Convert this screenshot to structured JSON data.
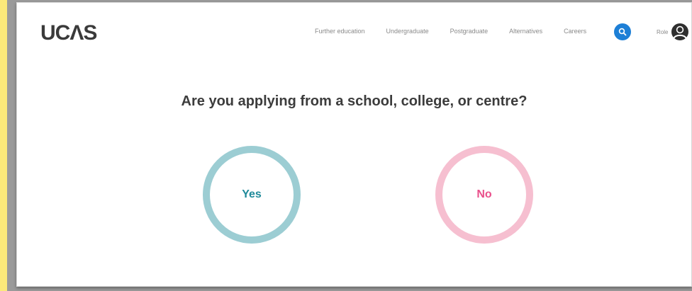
{
  "brand": {
    "logo_text": "UCΛS"
  },
  "nav": {
    "items": [
      {
        "label": "Further education"
      },
      {
        "label": "Undergraduate"
      },
      {
        "label": "Postgraduate"
      },
      {
        "label": "Alternatives"
      },
      {
        "label": "Careers"
      }
    ],
    "search_icon": "search-icon",
    "account_label": "Role",
    "account_icon": "user-icon"
  },
  "main": {
    "question": "Are you applying from a school, college, or centre?",
    "yes_label": "Yes",
    "no_label": "No"
  },
  "colors": {
    "yes_ring": "#9ccdd3",
    "yes_text": "#1f8a9a",
    "no_ring": "#f6bfd0",
    "no_text": "#e9508b",
    "search_bg": "#1d7fd6"
  }
}
